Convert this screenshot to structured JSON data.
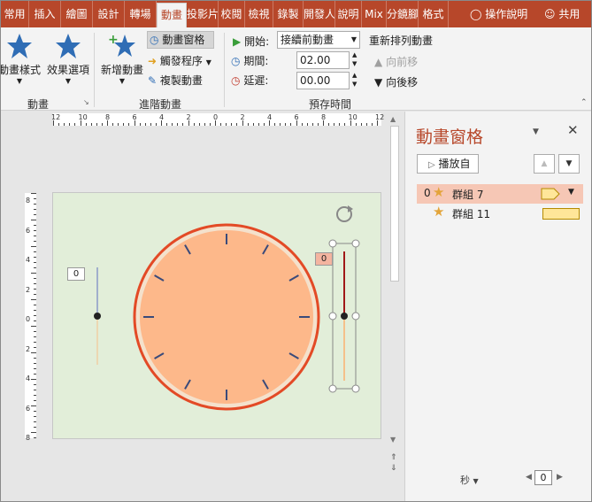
{
  "tabs": [
    "常用",
    "插入",
    "繪圖",
    "設計",
    "轉場",
    "動畫",
    "投影片",
    "校閱",
    "檢視",
    "錄製",
    "開發人員",
    "說明",
    "Mix",
    "分鏡腳本",
    "格式"
  ],
  "active_tab": "動畫",
  "tell_me": "操作說明",
  "share": "共用",
  "ribbon": {
    "animation_styles": "動畫樣式",
    "effect_options": "效果選項",
    "group_animation": "動畫",
    "add_animation": "新增動畫",
    "animation_pane": "動畫窗格",
    "trigger": "觸發程序",
    "animation_painter": "複製動畫",
    "group_advanced": "進階動畫",
    "start_label": "開始:",
    "start_value": "接續前動畫",
    "duration_label": "期間:",
    "duration_value": "02.00",
    "delay_label": "延遲:",
    "delay_value": "00.00",
    "group_timing": "預存時間",
    "reorder_title": "重新排列動畫",
    "move_earlier": "向前移",
    "move_later": "向後移"
  },
  "slide": {
    "marker_left": "0",
    "marker_right": "0"
  },
  "pane": {
    "title": "動畫窗格",
    "play_button": "播放自",
    "items": [
      {
        "index": "0",
        "name": "群組 7"
      },
      {
        "index": "",
        "name": "群組 11"
      }
    ],
    "seconds": "秒",
    "timeline_value": "0"
  },
  "colors": {
    "accent": "#b7472a",
    "clock_face": "#fdb88a",
    "clock_ring": "#e34a26",
    "slide_bg": "#e2eed9",
    "selected_item": "#f6c7b5",
    "timing_bar": "#ffe699"
  }
}
